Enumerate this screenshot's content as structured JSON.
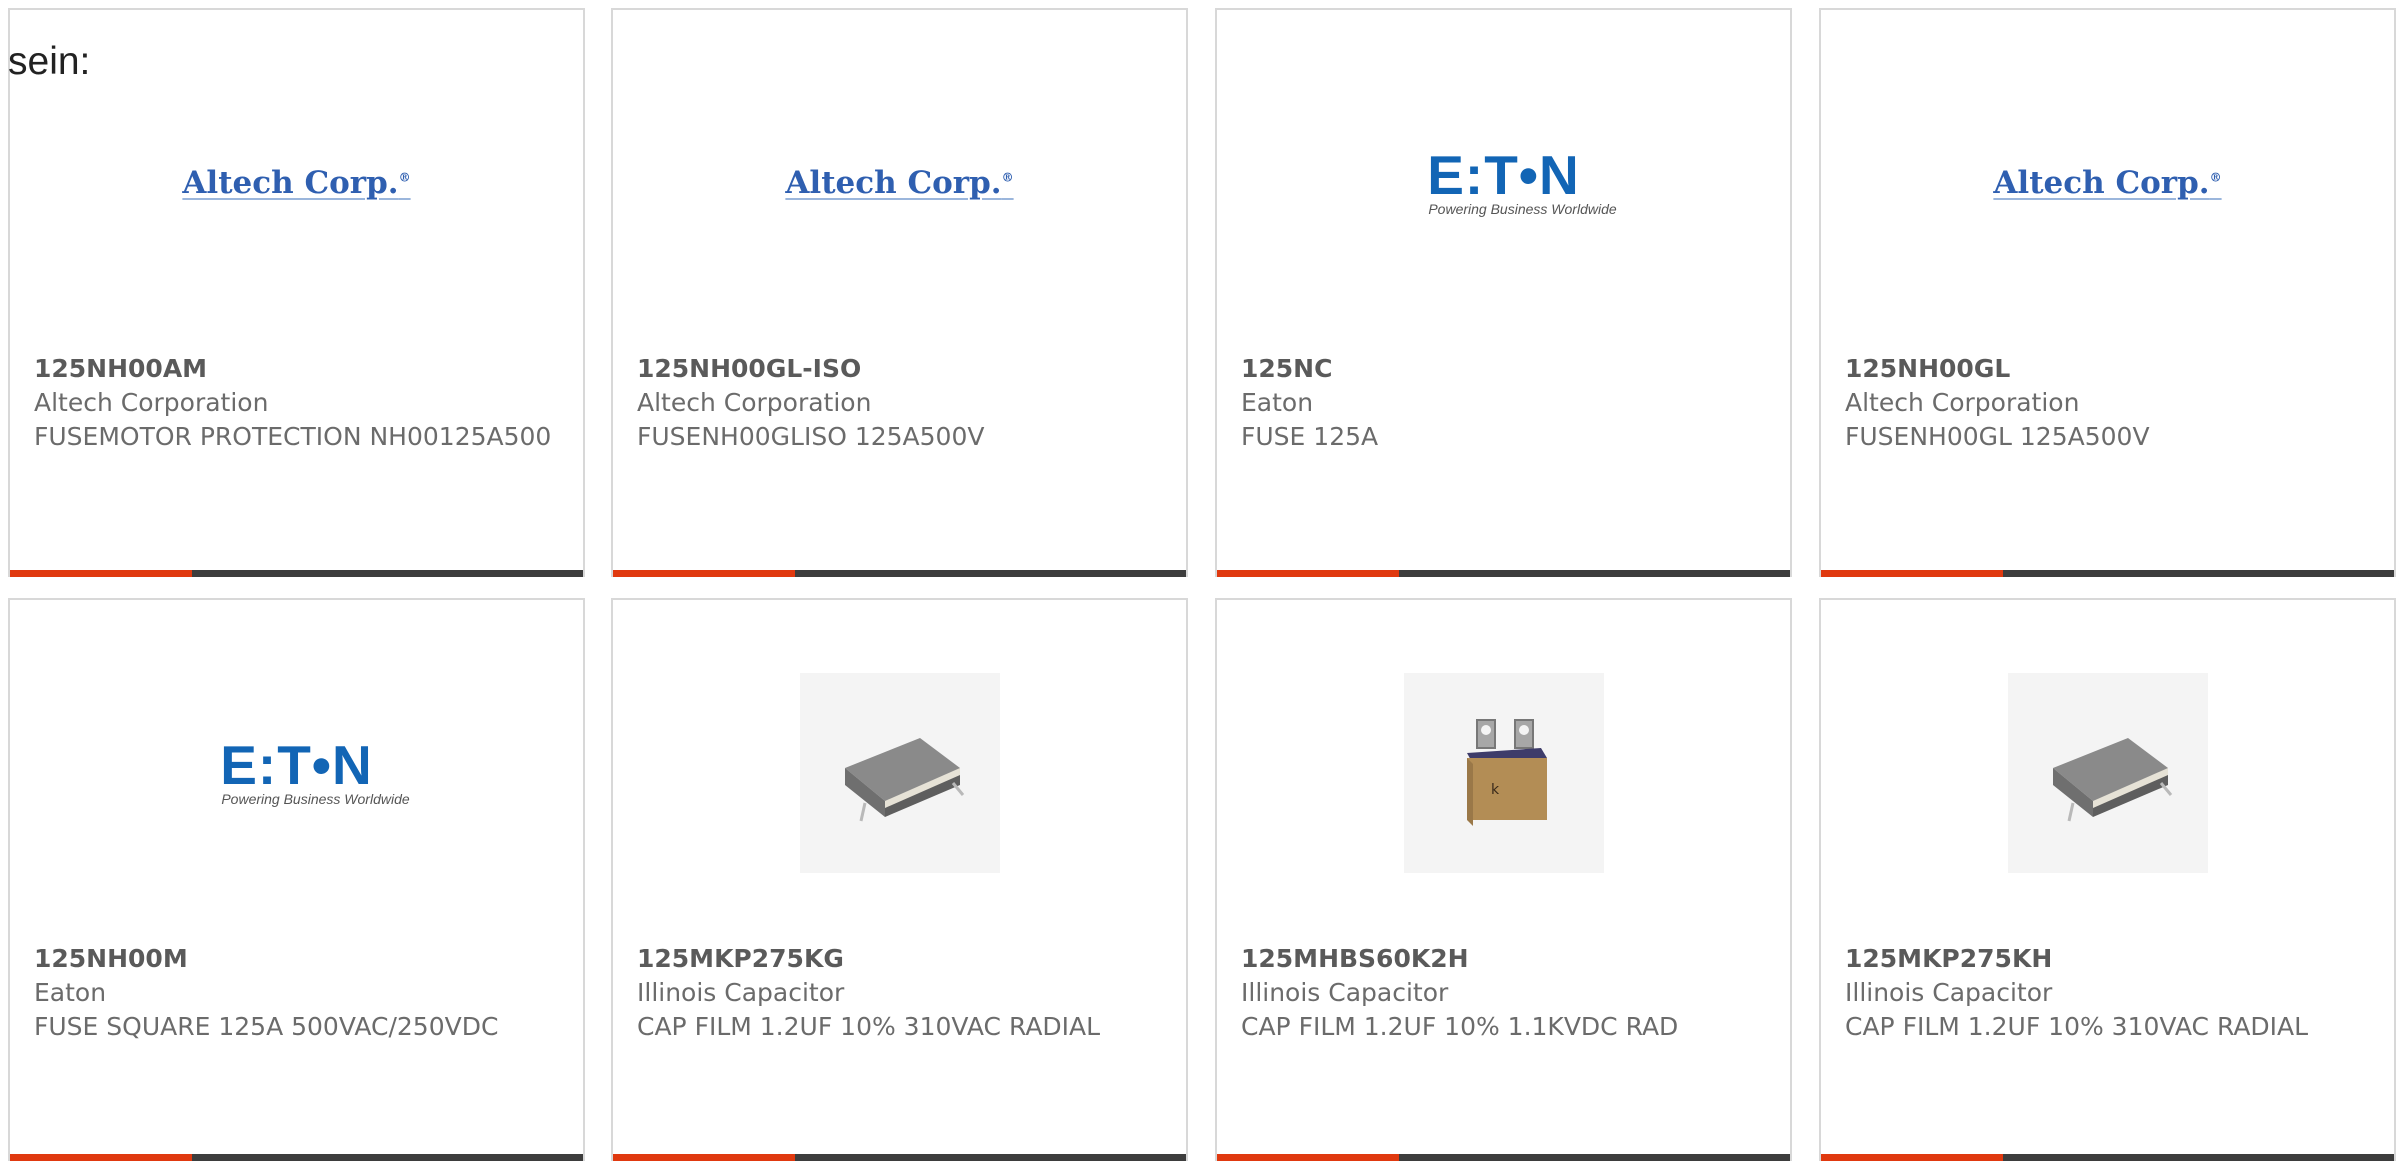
{
  "intro_text": "sein:",
  "colors": {
    "accent": "#e0390f",
    "bar": "#3d3d3d",
    "altech_blue": "#2f5fb0",
    "eaton_blue": "#1265b5",
    "text_gray": "#6b6b6b"
  },
  "logos": {
    "altech": {
      "text": "Altech Corp.",
      "mark": "®"
    },
    "eaton": {
      "text": "E:T•N",
      "tagline": "Powering Business Worldwide"
    }
  },
  "products": [
    {
      "image": "altech-logo",
      "part_number": "125NH00AM",
      "manufacturer": "Altech Corporation",
      "description": "FUSEMOTOR PROTECTION NH00125A500"
    },
    {
      "image": "altech-logo",
      "part_number": "125NH00GL-ISO",
      "manufacturer": "Altech Corporation",
      "description": "FUSENH00GLISO 125A500V"
    },
    {
      "image": "eaton-logo",
      "part_number": "125NC",
      "manufacturer": "Eaton",
      "description": "FUSE 125A"
    },
    {
      "image": "altech-logo",
      "part_number": "125NH00GL",
      "manufacturer": "Altech Corporation",
      "description": "FUSENH00GL 125A500V"
    },
    {
      "image": "eaton-logo",
      "part_number": "125NH00M",
      "manufacturer": "Eaton",
      "description": "FUSE SQUARE 125A 500VAC/250VDC"
    },
    {
      "image": "capacitor-gray-photo",
      "part_number": "125MKP275KG",
      "manufacturer": "Illinois Capacitor",
      "description": "CAP FILM 1.2UF 10% 310VAC RADIAL"
    },
    {
      "image": "capacitor-tan-photo",
      "part_number": "125MHBS60K2H",
      "manufacturer": "Illinois Capacitor",
      "description": "CAP FILM 1.2UF 10% 1.1KVDC RAD"
    },
    {
      "image": "capacitor-gray-photo",
      "part_number": "125MKP275KH",
      "manufacturer": "Illinois Capacitor",
      "description": "CAP FILM 1.2UF 10% 310VAC RADIAL"
    }
  ]
}
